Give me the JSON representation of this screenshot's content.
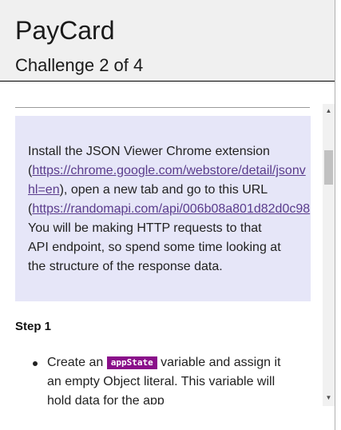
{
  "header": {
    "app_title": "PayCard",
    "subtitle": "Challenge 2 of 4"
  },
  "intro": {
    "line1": "Install the JSON Viewer Chrome extension",
    "link1_open": "(",
    "link1_text": "https://chrome.google.com/webstore/detail/jsonview/chklaanhfefbnpoihckbnefhakgolnmc?hl=en",
    "link1_visible_first": "https://chrome.google.com/webstore/detail/jsonv",
    "link1_visible_second": "hl=en",
    "after_link1": "), open a new tab and go to this URL",
    "link2_open": "(",
    "link2_visible": "https://randomapi.com/api/006b08a801d82d0c98",
    "line4": "You will be making HTTP requests to that",
    "line5": "API endpoint, so spend some time looking at",
    "line6": "the structure of the response data."
  },
  "step1": {
    "heading": "Step 1",
    "bullet_before": "Create an",
    "code": "appState",
    "bullet_after_line1": "variable and assign it",
    "bullet_line2": "an empty Object literal. This variable will",
    "bullet_line3": "hold data for the app"
  },
  "colors": {
    "intro_background": "#e6e6f8",
    "link": "#5a3b8c",
    "code_background": "#8a0f8a",
    "header_background": "#f0f0f0"
  },
  "icons": {
    "scroll_up": "scroll-up-arrow-icon",
    "scroll_down": "scroll-down-arrow-icon"
  }
}
